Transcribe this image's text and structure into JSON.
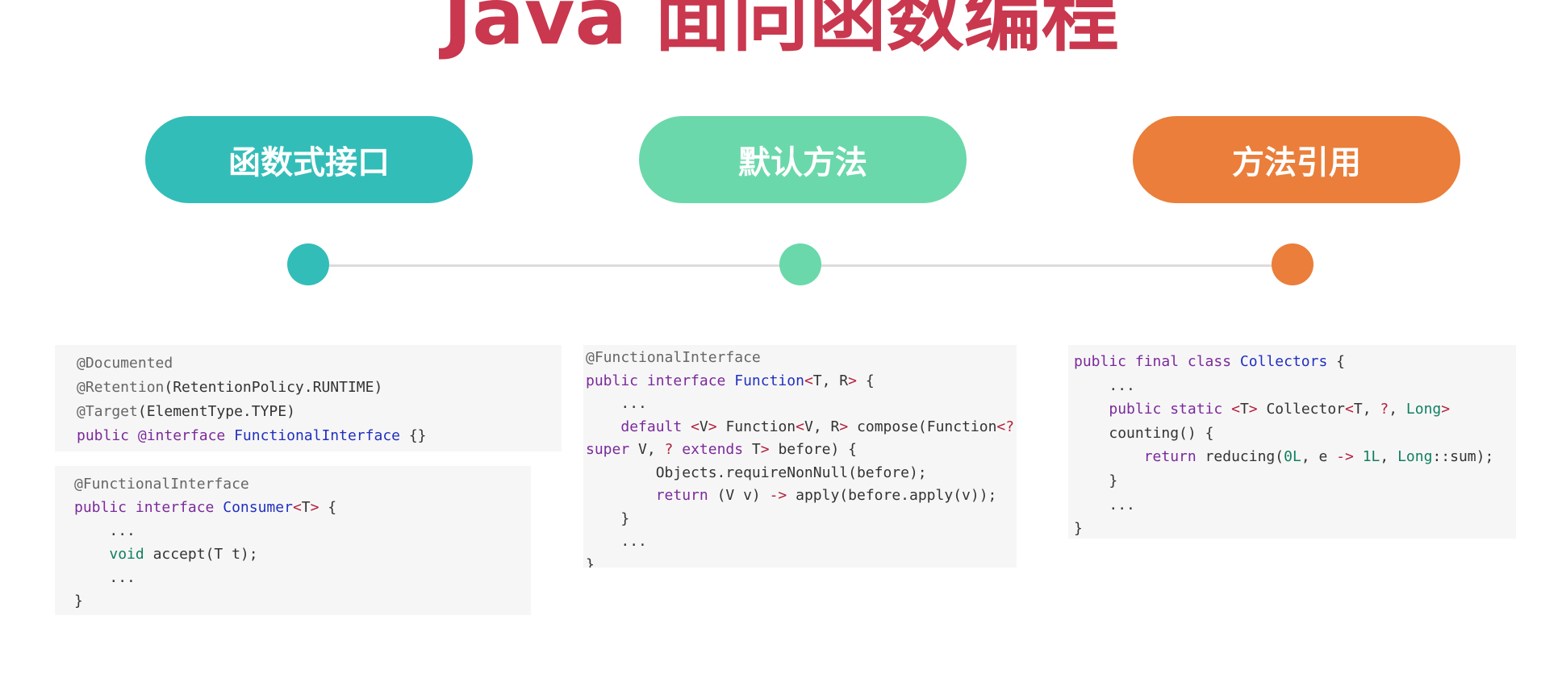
{
  "title": "Java 面向函数编程",
  "colors": {
    "title": "#c9384e",
    "teal": "#33bdb8",
    "mint": "#6ad8aa",
    "orange": "#ea7e3a",
    "timeline": "#dcdcdc"
  },
  "sections": [
    {
      "label": "函数式接口"
    },
    {
      "label": "默认方法"
    },
    {
      "label": "方法引用"
    }
  ],
  "code": {
    "a1": "@Documented",
    "a2": "@Retention",
    "a3": "RetentionPolicy.RUNTIME",
    "a4": "@Target",
    "a5": "ElementType.TYPE",
    "a6": "public",
    "a7": "@interface",
    "a8": "FunctionalInterface",
    "a9": "{}",
    "b1": "@FunctionalInterface",
    "b2": "public interface",
    "b3": "Consumer",
    "b4": "...",
    "b5": "void",
    "b6": "accept(T t);",
    "c1": "@FunctionalInterface",
    "c2": "public interface",
    "c3": "Function",
    "c4": "default",
    "c5": "Function",
    "c6": "compose(Function",
    "c7": "super",
    "c8": "extends",
    "c9": "before) {",
    "c10": "Objects.requireNonNull(before);",
    "c11": "return",
    "c12": "apply(before.apply(v));",
    "d1": "public final class",
    "d2": "Collectors",
    "d3": "public static",
    "d4": "Collector",
    "d5": "Long",
    "d6": "counting() {",
    "d7": "return",
    "d8": "reducing(",
    "d9": "0L",
    "d10": "1L",
    "d11": "::sum);"
  }
}
